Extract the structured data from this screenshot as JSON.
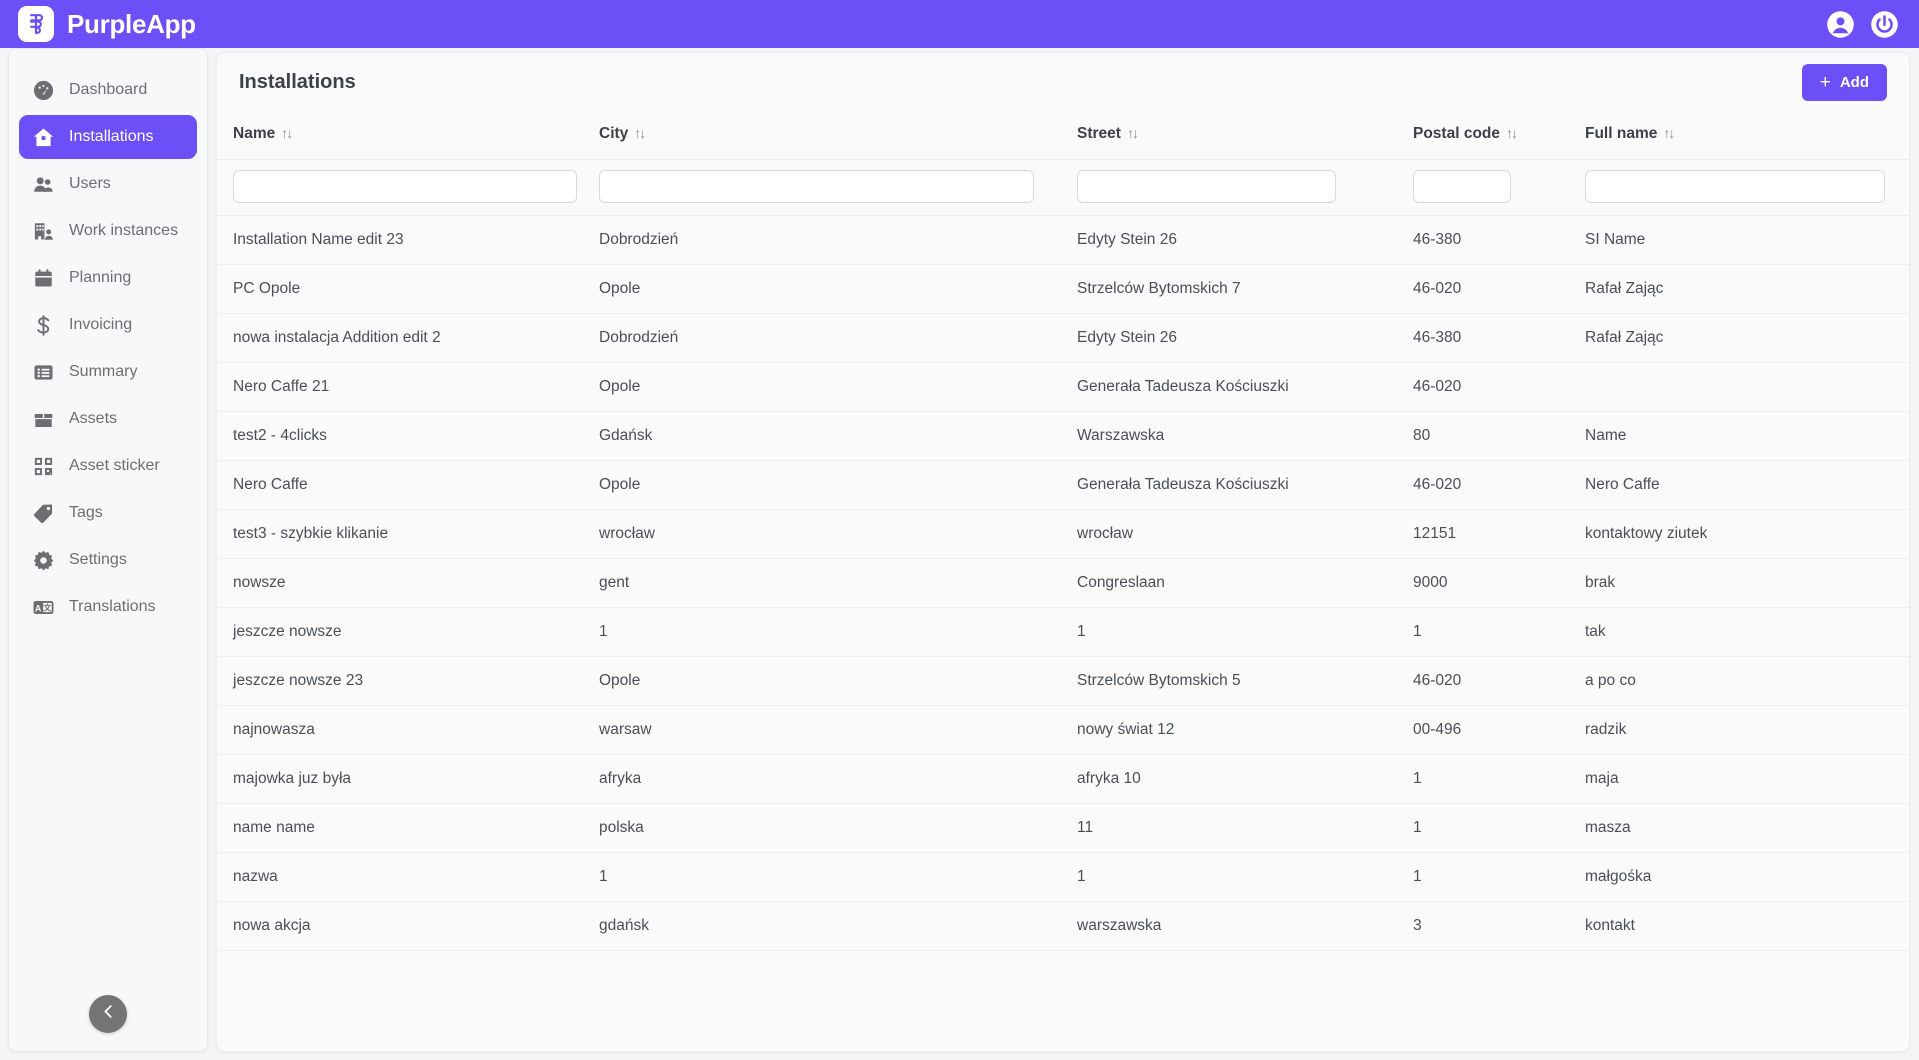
{
  "topbar": {
    "brand_name": "PurpleApp",
    "logo_icon": "purpleapp-logo-icon",
    "account_icon": "user-account-icon",
    "power_icon": "power-logout-icon",
    "brand_color": "#6c4ff6"
  },
  "sidebar": {
    "collapse_icon": "chevron-left-icon",
    "items": [
      {
        "label": "Dashboard",
        "icon": "dashboard-gauge-icon",
        "active": false
      },
      {
        "label": "Installations",
        "icon": "home-installation-icon",
        "active": true
      },
      {
        "label": "Users",
        "icon": "users-group-icon",
        "active": false
      },
      {
        "label": "Work instances",
        "icon": "building-worker-icon",
        "active": false
      },
      {
        "label": "Planning",
        "icon": "calendar-icon",
        "active": false
      },
      {
        "label": "Invoicing",
        "icon": "dollar-sign-icon",
        "active": false
      },
      {
        "label": "Summary",
        "icon": "list-summary-icon",
        "active": false
      },
      {
        "label": "Assets",
        "icon": "box-assets-icon",
        "active": false
      },
      {
        "label": "Asset sticker",
        "icon": "qr-sticker-icon",
        "active": false
      },
      {
        "label": "Tags",
        "icon": "tag-icon",
        "active": false
      },
      {
        "label": "Settings",
        "icon": "gear-icon",
        "active": false
      },
      {
        "label": "Translations",
        "icon": "translate-icon",
        "active": false
      }
    ]
  },
  "main": {
    "page_title": "Installations",
    "add_button": {
      "label": "Add",
      "plus": "+"
    }
  },
  "table": {
    "sort_glyph": "↑↓",
    "columns": [
      {
        "key": "name",
        "label": "Name",
        "filter_value": "",
        "filter_placeholder": ""
      },
      {
        "key": "city",
        "label": "City",
        "filter_value": "",
        "filter_placeholder": ""
      },
      {
        "key": "street",
        "label": "Street",
        "filter_value": "",
        "filter_placeholder": ""
      },
      {
        "key": "postal",
        "label": "Postal code",
        "filter_value": "",
        "filter_placeholder": ""
      },
      {
        "key": "full",
        "label": "Full name",
        "filter_value": "",
        "filter_placeholder": ""
      }
    ],
    "rows": [
      {
        "name": "Installation Name edit 23",
        "city": "Dobrodzień",
        "street": "Edyty Stein 26",
        "postal": "46-380",
        "full": "SI Name"
      },
      {
        "name": "PC Opole",
        "city": "Opole",
        "street": "Strzelców Bytomskich 7",
        "postal": "46-020",
        "full": "Rafał Zając"
      },
      {
        "name": "nowa instalacja Addition edit 2",
        "city": "Dobrodzień",
        "street": "Edyty Stein 26",
        "postal": "46-380",
        "full": "Rafał Zając"
      },
      {
        "name": "Nero Caffe 21",
        "city": "Opole",
        "street": "Generała Tadeusza Kościuszki",
        "postal": "46-020",
        "full": ""
      },
      {
        "name": "test2 - 4clicks",
        "city": "Gdańsk",
        "street": "Warszawska",
        "postal": "80",
        "full": "Name"
      },
      {
        "name": "Nero Caffe",
        "city": "Opole",
        "street": "Generała Tadeusza Kościuszki",
        "postal": "46-020",
        "full": "Nero Caffe"
      },
      {
        "name": "test3 - szybkie klikanie",
        "city": "wrocław",
        "street": "wrocław",
        "postal": "12151",
        "full": "kontaktowy ziutek"
      },
      {
        "name": "nowsze",
        "city": "gent",
        "street": "Congreslaan",
        "postal": "9000",
        "full": "brak"
      },
      {
        "name": "jeszcze nowsze",
        "city": "1",
        "street": "1",
        "postal": "1",
        "full": "tak"
      },
      {
        "name": "jeszcze nowsze 23",
        "city": "Opole",
        "street": "Strzelców Bytomskich 5",
        "postal": "46-020",
        "full": "a po co"
      },
      {
        "name": "najnowasza",
        "city": "warsaw",
        "street": "nowy świat 12",
        "postal": "00-496",
        "full": "radzik"
      },
      {
        "name": "majowka juz była",
        "city": "afryka",
        "street": "afryka 10",
        "postal": "1",
        "full": "maja"
      },
      {
        "name": "name name",
        "city": "polska",
        "street": "11",
        "postal": "1",
        "full": "masza"
      },
      {
        "name": "nazwa",
        "city": "1",
        "street": "1",
        "postal": "1",
        "full": "małgośka"
      },
      {
        "name": "nowa akcja",
        "city": "gdańsk",
        "street": "warszawska",
        "postal": "3",
        "full": "kontakt"
      }
    ]
  }
}
